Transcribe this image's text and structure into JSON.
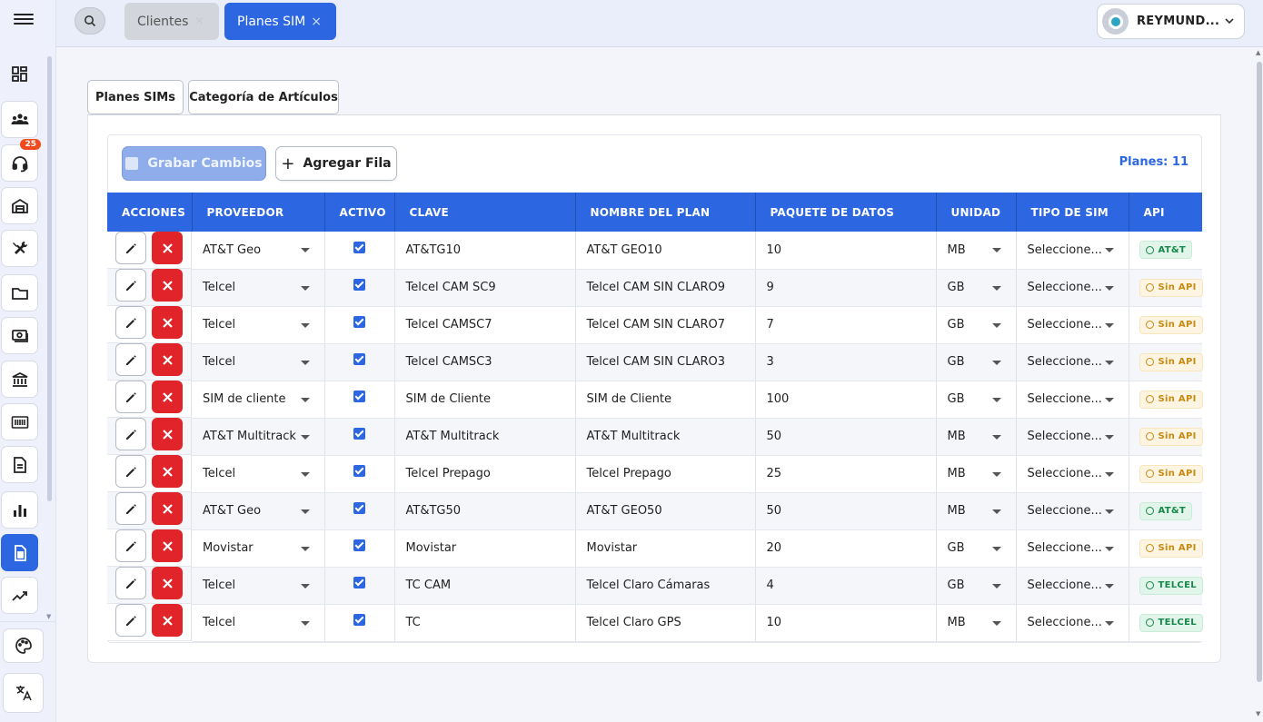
{
  "topbar": {
    "tabs": [
      {
        "label": "Clientes",
        "close": "×"
      },
      {
        "label": "Planes SIM",
        "close": "×"
      }
    ],
    "user_name": "REYMUND..."
  },
  "sidebar": {
    "badge_count": "25",
    "icons": [
      "dashboard-icon",
      "users-icon",
      "headset-icon",
      "warehouse-icon",
      "tools-icon",
      "folder-icon",
      "money-icon",
      "bank-icon",
      "barcode-icon",
      "document-icon",
      "bar-chart-icon",
      "sim-card-icon",
      "trend-icon",
      "palette-icon",
      "translate-icon"
    ]
  },
  "subtabs": [
    "Planes SIMs",
    "Categoría de Artículos"
  ],
  "toolbar": {
    "save_label": "Grabar Cambios",
    "add_label": "Agregar Fila",
    "count_label": "Planes: 11"
  },
  "table": {
    "headers": [
      "ACCIONES",
      "PROVEEDOR",
      "ACTIVO",
      "CLAVE",
      "NOMBRE DEL PLAN",
      "PAQUETE DE DATOS",
      "UNIDAD",
      "TIPO DE SIM",
      "API"
    ],
    "rows": [
      {
        "proveedor": "AT&T Geo",
        "activo": true,
        "clave": "AT&TG10",
        "nombre": "AT&T GEO10",
        "paquete": "10",
        "unidad": "MB",
        "tipo": "Seleccione...",
        "api": "AT&T",
        "api_ok": true
      },
      {
        "proveedor": "Telcel",
        "activo": true,
        "clave": "Telcel CAM SC9",
        "nombre": "Telcel CAM SIN CLARO9",
        "paquete": "9",
        "unidad": "GB",
        "tipo": "Seleccione...",
        "api": "Sin API",
        "api_ok": false
      },
      {
        "proveedor": "Telcel",
        "activo": true,
        "clave": "Telcel CAMSC7",
        "nombre": "Telcel CAM SIN CLARO7",
        "paquete": "7",
        "unidad": "GB",
        "tipo": "Seleccione...",
        "api": "Sin API",
        "api_ok": false
      },
      {
        "proveedor": "Telcel",
        "activo": true,
        "clave": "Telcel CAMSC3",
        "nombre": "Telcel CAM SIN CLARO3",
        "paquete": "3",
        "unidad": "GB",
        "tipo": "Seleccione...",
        "api": "Sin API",
        "api_ok": false
      },
      {
        "proveedor": "SIM de cliente",
        "activo": true,
        "clave": "SIM de Cliente",
        "nombre": "SIM de Cliente",
        "paquete": "100",
        "unidad": "GB",
        "tipo": "Seleccione...",
        "api": "Sin API",
        "api_ok": false
      },
      {
        "proveedor": "AT&T Multitrack",
        "activo": true,
        "clave": "AT&T Multitrack",
        "nombre": "AT&T Multitrack",
        "paquete": "50",
        "unidad": "MB",
        "tipo": "Seleccione...",
        "api": "Sin API",
        "api_ok": false
      },
      {
        "proveedor": "Telcel",
        "activo": true,
        "clave": "Telcel Prepago",
        "nombre": "Telcel Prepago",
        "paquete": "25",
        "unidad": "MB",
        "tipo": "Seleccione...",
        "api": "Sin API",
        "api_ok": false
      },
      {
        "proveedor": "AT&T Geo",
        "activo": true,
        "clave": "AT&TG50",
        "nombre": "AT&T GEO50",
        "paquete": "50",
        "unidad": "MB",
        "tipo": "Seleccione...",
        "api": "AT&T",
        "api_ok": true
      },
      {
        "proveedor": "Movistar",
        "activo": true,
        "clave": "Movistar",
        "nombre": "Movistar",
        "paquete": "20",
        "unidad": "GB",
        "tipo": "Seleccione...",
        "api": "Sin API",
        "api_ok": false
      },
      {
        "proveedor": "Telcel",
        "activo": true,
        "clave": "TC CAM",
        "nombre": "Telcel Claro Cámaras",
        "paquete": "4",
        "unidad": "GB",
        "tipo": "Seleccione...",
        "api": "TELCEL",
        "api_ok": true
      },
      {
        "proveedor": "Telcel",
        "activo": true,
        "clave": "TC",
        "nombre": "Telcel Claro GPS",
        "paquete": "10",
        "unidad": "MB",
        "tipo": "Seleccione...",
        "api": "TELCEL",
        "api_ok": true
      }
    ]
  },
  "colors": {
    "accent": "#2c66e0",
    "delete": "#e0242a",
    "api_ok": "#16894a",
    "api_none": "#c88a10"
  }
}
